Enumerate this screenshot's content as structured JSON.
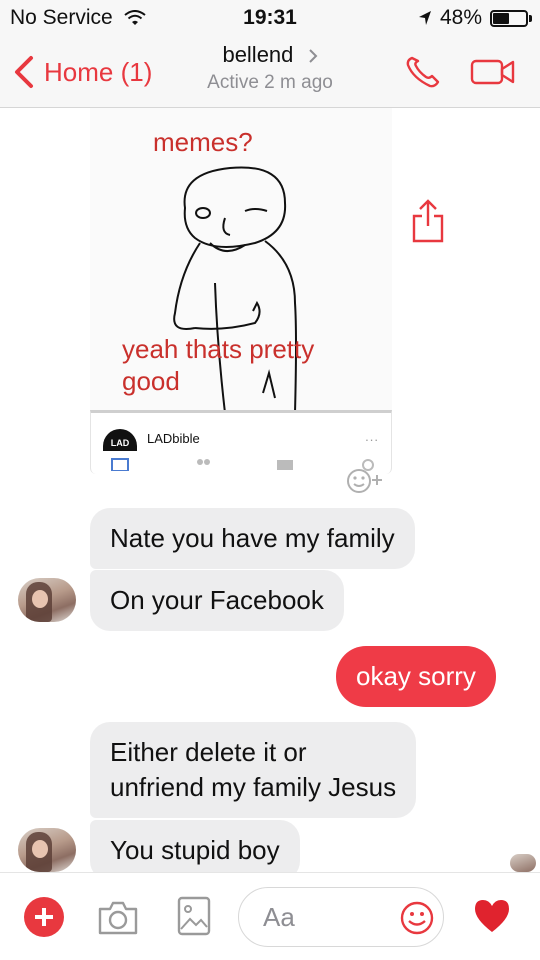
{
  "status_bar": {
    "carrier": "No Service",
    "time": "19:31",
    "battery_percent": "48%",
    "battery_level": 0.48,
    "icons": [
      "wifi-icon",
      "location-arrow-icon",
      "battery-icon"
    ]
  },
  "nav": {
    "back_label": "Home (1)",
    "contact_name": "bellend",
    "contact_status": "Active 2 m ago",
    "accent_color": "#e8383f",
    "icons": [
      "back-chevron-icon",
      "chevron-right-icon",
      "phone-icon",
      "video-camera-icon"
    ]
  },
  "shared_post": {
    "meme_top_text": "memes?",
    "meme_bottom_text": "yeah thats pretty good",
    "source_logo": "LAD",
    "source_name": "LADbible",
    "more": "...",
    "icons": [
      "share-icon",
      "add-reaction-icon"
    ]
  },
  "messages": [
    {
      "sender": "them",
      "text": "Nate you have my family"
    },
    {
      "sender": "them",
      "text": "On your Facebook"
    },
    {
      "sender": "me",
      "text": "okay sorry"
    },
    {
      "sender": "them",
      "text": "Either delete it or"
    },
    {
      "sender": "them",
      "text": "unfriend my family Jesus"
    },
    {
      "sender": "them",
      "text": "You stupid boy"
    }
  ],
  "composer": {
    "placeholder": "Aa",
    "icons": [
      "plus-icon",
      "camera-icon",
      "gallery-icon",
      "emoji-icon",
      "heart-icon"
    ],
    "bubble_out_color": "#ef3b47",
    "bubble_in_color": "#ededee"
  }
}
